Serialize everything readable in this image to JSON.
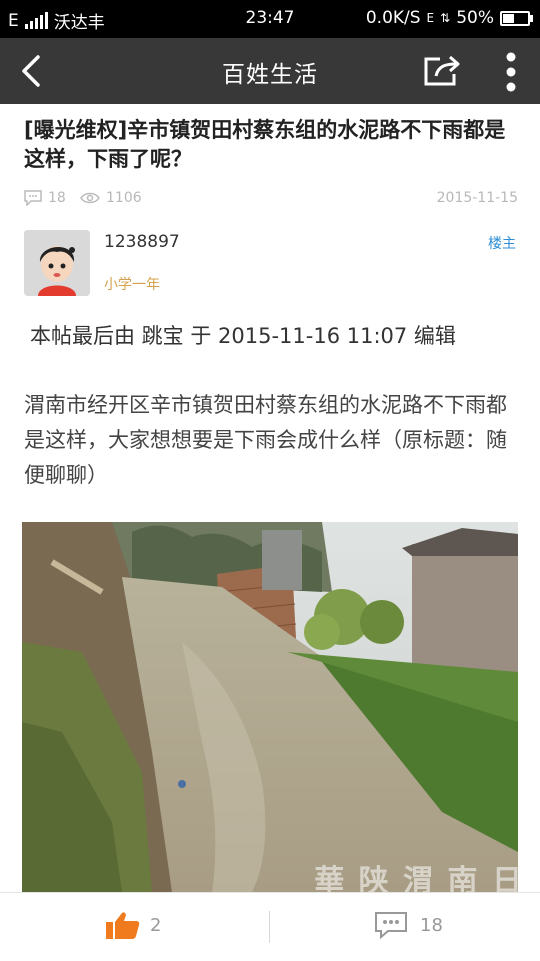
{
  "status_bar": {
    "network_type": "E",
    "carrier": "沃达丰",
    "time": "23:47",
    "net_speed": "0.0K/S",
    "data_type": "E",
    "battery_percent": "50%",
    "battery_level": 0.5
  },
  "nav": {
    "title": "百姓生活",
    "back_icon": "chevron-left-icon",
    "share_icon": "share-icon",
    "more_icon": "more-vertical-icon"
  },
  "post": {
    "title": "[曝光维权]辛市镇贺田村蔡东组的水泥路不下雨都是这样，下雨了呢？",
    "comment_count": "18",
    "view_count": "1106",
    "date": "2015-11-15",
    "author": {
      "username": "1238897",
      "level": "小学一年",
      "badge": "楼主"
    },
    "edit_note": "本帖最后由 跳宝 于 2015-11-16 11:07 编辑",
    "body": "渭南市经开区辛市镇贺田村蔡东组的水泥路不下雨都是这样，大家想想要是下雨会成什么样（原标题：随便聊聊）",
    "image_watermark": "華 陕 渭 南 日"
  },
  "bottom_bar": {
    "like_count": "2",
    "comment_count": "18",
    "like_color": "#f07b1e"
  }
}
